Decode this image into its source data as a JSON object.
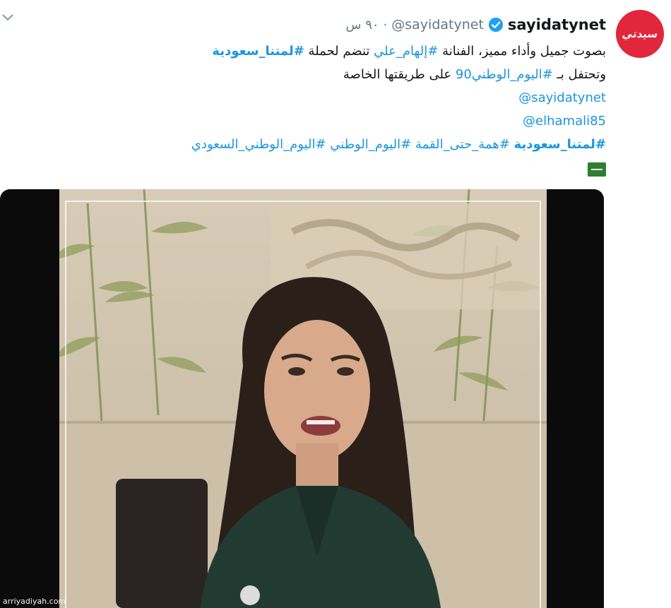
{
  "tweet": {
    "display_name": "sayidatynet",
    "handle": "@sayidatynet",
    "time": "٩٠ س",
    "separator": "·",
    "avatar_logo_text": "سيدتي",
    "body": {
      "line1_text": "بصوت جميل وأداء مميز، الفنانة ",
      "line1_tag1": "#إلهام_علي",
      "line1_text2": " تنضم لحملة ",
      "line1_tag2": "#لمتنا_سعودية",
      "line2_text": "وتحتفل بـ ",
      "line2_tag": "#اليوم_الوطني90",
      "line2_text2": " على طريقتها الخاصة",
      "mention1": "@sayidatynet",
      "mention2": "@elhamali85",
      "tags_line": [
        "#لمتنا_سعودية",
        "#همة_حتى_القمة",
        "#اليوم_الوطني",
        "#اليوم_الوطني_السعودي"
      ]
    }
  },
  "watermark": "arriyadiyah.com",
  "colors": {
    "link": "#1b95e0",
    "verified": "#1da1f2",
    "avatar_bg": "#e2263c",
    "flag": "#2e7d32"
  },
  "icons": [
    "chevron-down-icon",
    "verified-badge-icon",
    "saudi-flag-emoji"
  ]
}
